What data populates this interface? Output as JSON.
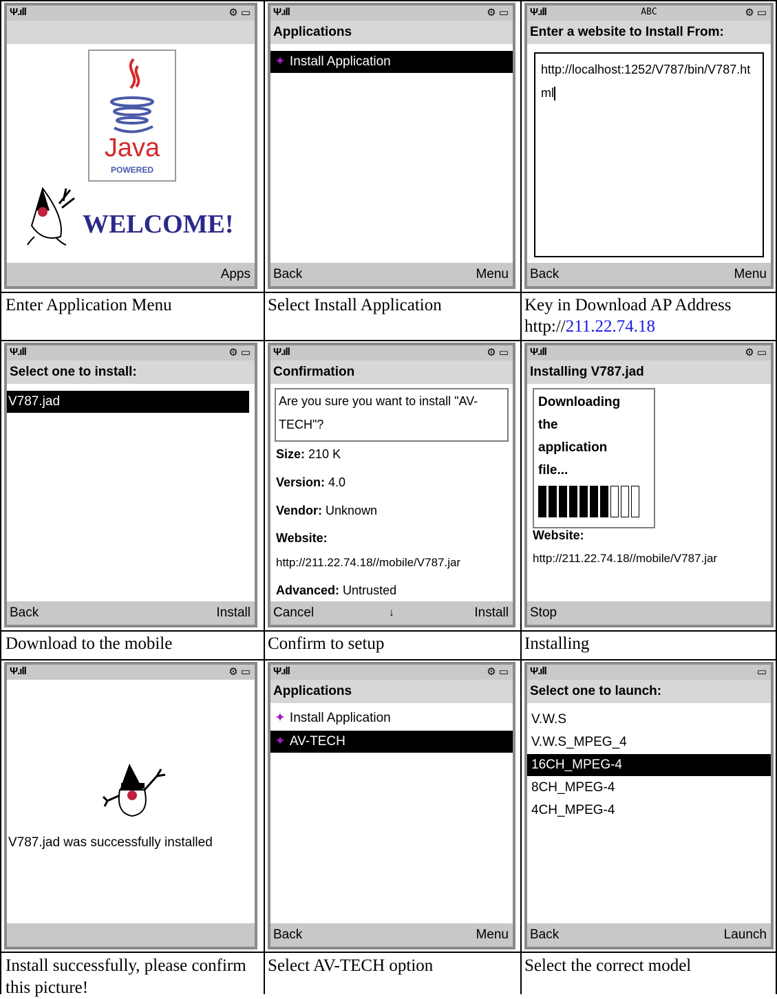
{
  "status_icons": {
    "signal": "signal-icon",
    "settings": "settings-icon",
    "battery": "battery-icon"
  },
  "panels": [
    {
      "softkeys": {
        "right": "Apps"
      },
      "welcome_text": "WELCOME!",
      "logo_text": "Java",
      "logo_subtext": "POWERED",
      "caption": "Enter Application Menu"
    },
    {
      "title": "Applications",
      "items": [
        "Install Application"
      ],
      "softkeys": {
        "left": "Back",
        "right": "Menu"
      },
      "caption": "Select Install Application"
    },
    {
      "input_mode": "ABC",
      "title": "Enter a website to Install From:",
      "input_value": "http://localhost:1252/V787/bin/V787.html",
      "softkeys": {
        "left": "Back",
        "right": "Menu"
      },
      "caption_prefix": "Key in Download AP Address http://",
      "caption_link": "211.22.74.18"
    },
    {
      "title": "Select one to install:",
      "items": [
        "V787.jad"
      ],
      "softkeys": {
        "left": "Back",
        "right": "Install"
      },
      "caption": "Download to the mobile"
    },
    {
      "title": "Confirmation",
      "question": "Are you sure you want to install \"AV-TECH\"?",
      "size_label": "Size:",
      "size_value": "210 K",
      "version_label": "Version:",
      "version_value": "4.0",
      "vendor_label": "Vendor:",
      "vendor_value": "Unknown",
      "website_label": "Website:",
      "website_value": "http://211.22.74.18//mobile/V787.jar",
      "advanced_label": "Advanced:",
      "advanced_value": "Untrusted",
      "softkeys": {
        "left": "Cancel",
        "middle": "↓",
        "right": "Install"
      },
      "caption": "Confirm to setup"
    },
    {
      "title": "Installing V787.jad",
      "progress_text": "Downloading the application file...",
      "progress": 0.7,
      "website_label": "Website:",
      "website_value": "http://211.22.74.18//mobile/V787.jar",
      "softkeys": {
        "left": "Stop"
      },
      "caption": "Installing"
    },
    {
      "message": "V787.jad was successfully installed",
      "caption": "Install successfully, please confirm this picture!"
    },
    {
      "title": "Applications",
      "items": [
        "Install Application",
        "AV-TECH"
      ],
      "softkeys": {
        "left": "Back",
        "right": "Menu"
      },
      "caption": "Select AV-TECH option"
    },
    {
      "title": "Select one to launch:",
      "items": [
        "V.W.S",
        "V.W.S_MPEG_4",
        "16CH_MPEG-4",
        "8CH_MPEG-4",
        "4CH_MPEG-4"
      ],
      "softkeys": {
        "left": "Back",
        "right": "Launch"
      },
      "caption": "Select the correct model"
    }
  ]
}
